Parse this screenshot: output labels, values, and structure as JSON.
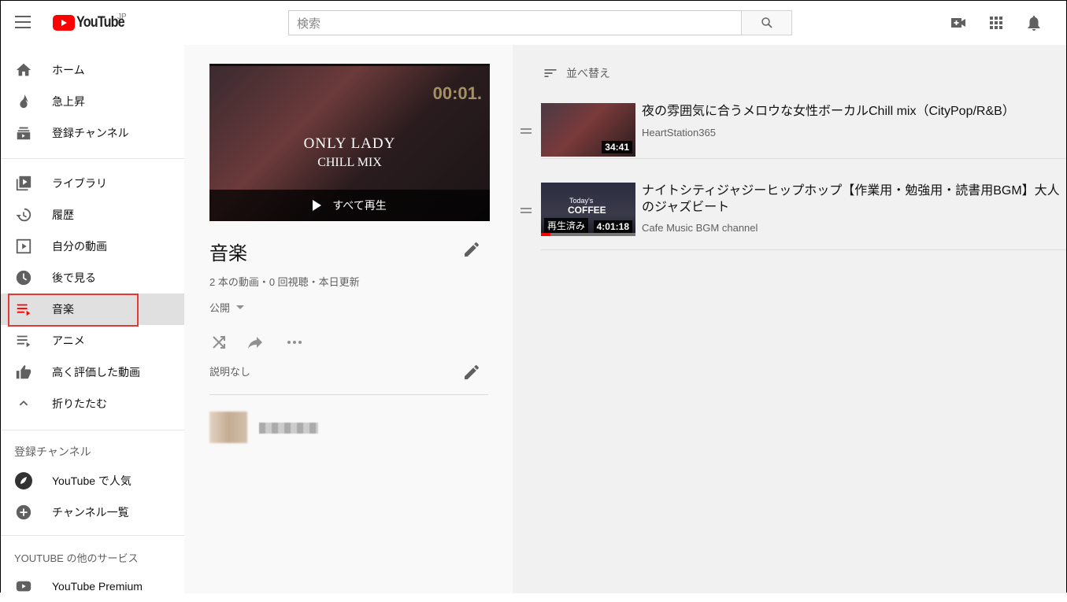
{
  "header": {
    "logo_text": "YouTube",
    "region": "JP",
    "search_placeholder": "検索"
  },
  "sidebar": {
    "main": [
      {
        "label": "ホーム",
        "icon": "home-icon"
      },
      {
        "label": "急上昇",
        "icon": "fire-icon"
      },
      {
        "label": "登録チャンネル",
        "icon": "subscriptions-icon"
      }
    ],
    "library": [
      {
        "label": "ライブラリ",
        "icon": "library-icon"
      },
      {
        "label": "履歴",
        "icon": "history-icon"
      },
      {
        "label": "自分の動画",
        "icon": "my-videos-icon"
      },
      {
        "label": "後で見る",
        "icon": "watch-later-icon"
      },
      {
        "label": "音楽",
        "icon": "playlist-icon",
        "selected": true
      },
      {
        "label": "アニメ",
        "icon": "playlist-icon"
      },
      {
        "label": "高く評価した動画",
        "icon": "thumbs-up-icon"
      },
      {
        "label": "折りたたむ",
        "icon": "chevron-up-icon"
      }
    ],
    "subs_heading": "登録チャンネル",
    "subs": [
      {
        "label": "YouTube で人気"
      },
      {
        "label": "チャンネル一覧"
      }
    ],
    "more_heading": "YOUTUBE の他のサービス",
    "more": [
      {
        "label": "YouTube Premium"
      }
    ]
  },
  "playlist": {
    "thumb_title_1": "Only Lady",
    "thumb_title_2": "Chill Mix",
    "play_all": "すべて再生",
    "title": "音楽",
    "stats": "2 本の動画・0 回視聴・本日更新",
    "privacy": "公開",
    "description": "説明なし"
  },
  "main": {
    "sort_label": "並べ替え",
    "videos": [
      {
        "title": "夜の雰囲気に合うメロウな女性ボーカルChill mix（CityPop/R&B）",
        "channel": "HeartStation365",
        "duration": "34:41"
      },
      {
        "title": "ナイトシティジャジーヒップホップ【作業用・勉強用・読書用BGM】大人のジャズビート",
        "channel": "Cafe Music BGM channel",
        "duration": "4:01:18",
        "watched": "再生済み",
        "thumb_text_1": "Today's",
        "thumb_text_2": "COFFEE",
        "progress": 0.1
      }
    ]
  },
  "colors": {
    "accent": "#ff0000",
    "selected_bg": "#e0e0e0",
    "highlight_box": "#e53935"
  }
}
